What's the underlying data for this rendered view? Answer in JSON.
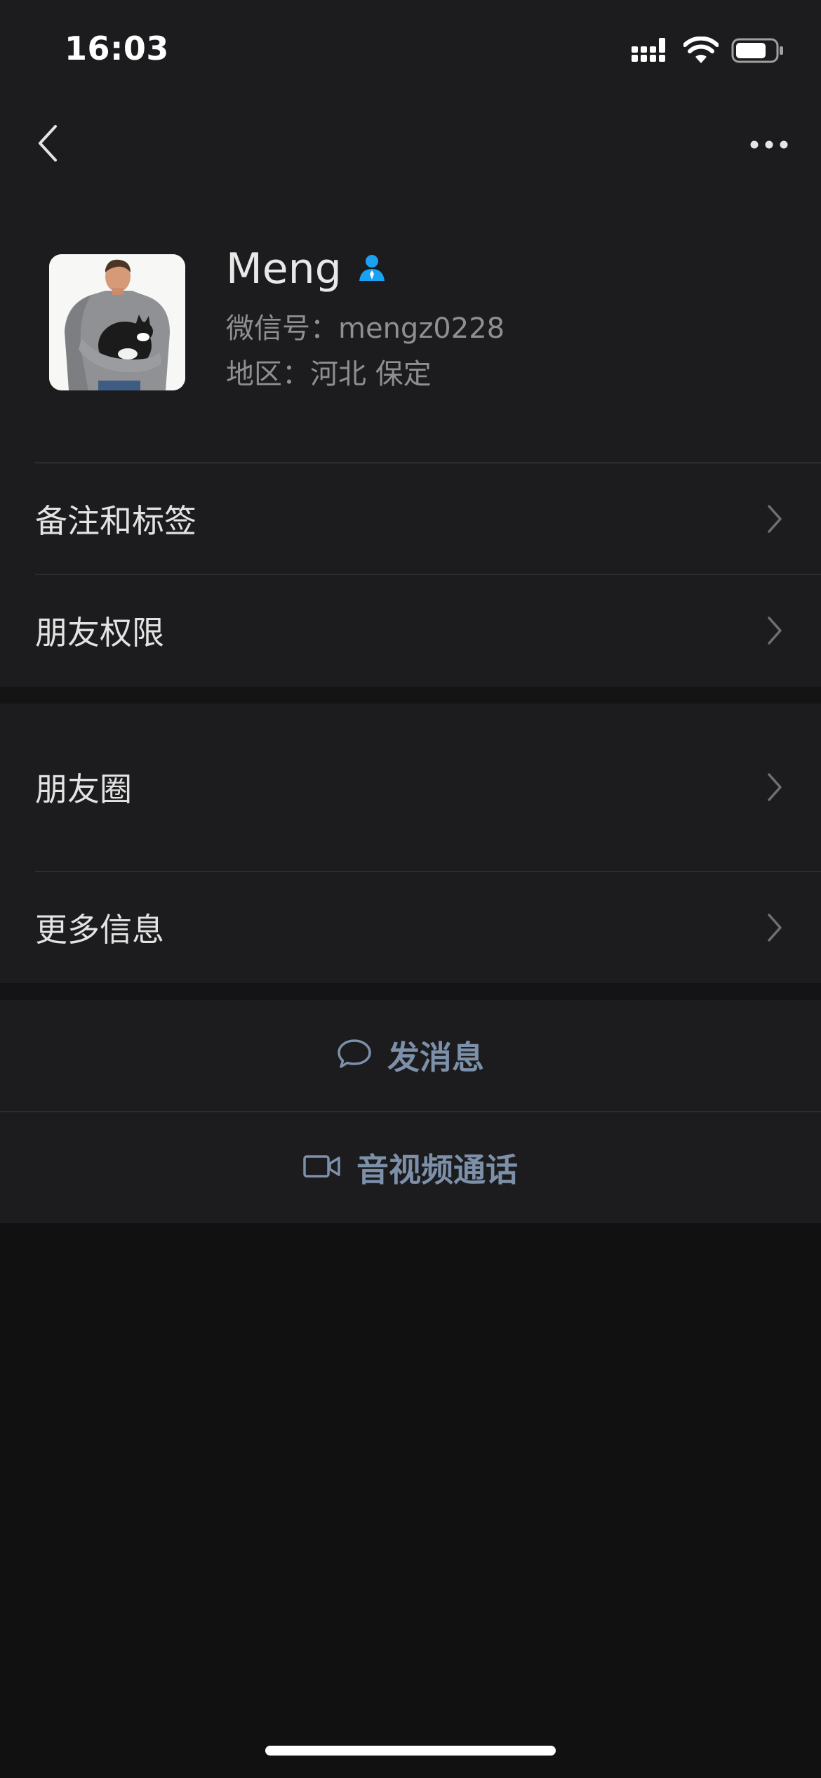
{
  "status_bar": {
    "time": "16:03",
    "icons": [
      "signal-icon",
      "wifi-icon",
      "battery-icon"
    ]
  },
  "nav": {
    "back_icon": "chevron-left-icon",
    "more_icon": "more-horizontal-icon"
  },
  "profile": {
    "name": "Meng",
    "badge_icon": "person-icon",
    "wechat_id": "微信号：mengz0228",
    "region": "地区：河北 保定",
    "colors": {
      "badge": "#1aa1f2"
    }
  },
  "menu_group_1": [
    {
      "label": "备注和标签"
    },
    {
      "label": "朋友权限"
    }
  ],
  "menu_group_2": [
    {
      "label": "朋友圈"
    },
    {
      "label": "更多信息"
    }
  ],
  "actions": {
    "message_label": "发消息",
    "message_icon": "chat-bubble-icon",
    "call_label": "音视频通话",
    "call_icon": "video-camera-icon",
    "accent_color": "#7d90a9"
  }
}
